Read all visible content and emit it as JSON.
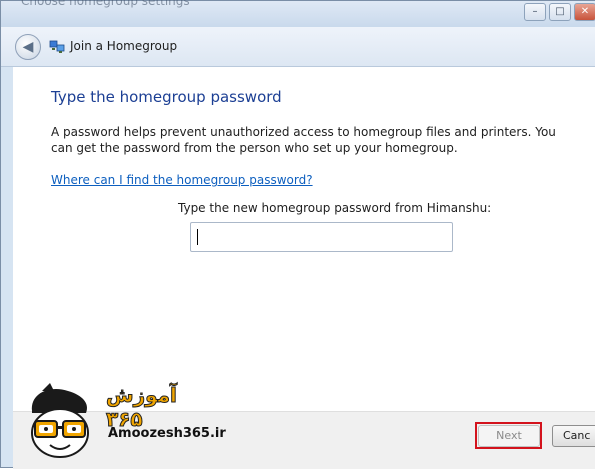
{
  "window": {
    "background_title": "Choose homegroup settings",
    "title": "Join a Homegroup",
    "controls": {
      "minimize": "–",
      "maximize": "□",
      "close": "✕"
    }
  },
  "nav": {
    "back_icon": "back-arrow-icon",
    "back_glyph": "◀"
  },
  "main": {
    "heading": "Type the homegroup password",
    "description": "A password helps prevent unauthorized access to homegroup files and printers. You can get the password from the person who set up your homegroup.",
    "help_link": "Where can I find the homegroup password?",
    "field_label": "Type the new homegroup password from Himanshu:",
    "password_value": ""
  },
  "footer": {
    "next_label": "Next",
    "cancel_label": "Canc"
  },
  "watermark": {
    "site": "Amoozesh365.ir",
    "persian_text": "آموزش ۳۶۵"
  },
  "colors": {
    "heading": "#1c3f94",
    "link": "#0d5fbf",
    "highlight": "#d3121c",
    "logo_accent": "#f0a500"
  }
}
